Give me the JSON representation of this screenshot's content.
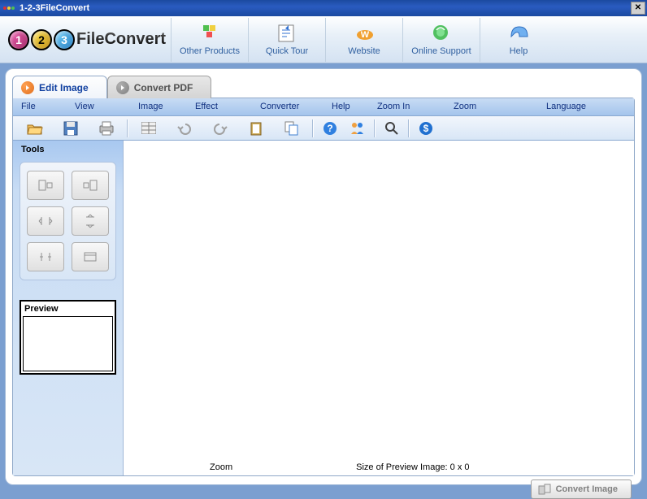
{
  "title": "1-2-3FileConvert",
  "logo": {
    "c1": "1",
    "c2": "2",
    "c3": "3",
    "text": "FileConvert"
  },
  "header_buttons": [
    {
      "label": "Other Products",
      "icon": "products-icon"
    },
    {
      "label": "Quick Tour",
      "icon": "quicktour-icon"
    },
    {
      "label": "Website",
      "icon": "website-icon"
    },
    {
      "label": "Online Support",
      "icon": "support-icon"
    },
    {
      "label": "Help",
      "icon": "help-icon"
    }
  ],
  "tabs": {
    "active": {
      "label": "Edit Image"
    },
    "inactive": {
      "label": "Convert PDF"
    }
  },
  "menu": [
    "File",
    "View",
    "Image",
    "Effect",
    "Converter",
    "Help",
    "Zoom In",
    "Zoom",
    "Language"
  ],
  "menu_widths": [
    66,
    78,
    70,
    80,
    88,
    56,
    94,
    114,
    60
  ],
  "sidebar": {
    "title": "Tools",
    "preview_title": "Preview"
  },
  "status": {
    "zoom_label": "Zoom",
    "size_label": "Size of Preview Image: 0 x 0"
  },
  "convert_button": "Convert Image"
}
